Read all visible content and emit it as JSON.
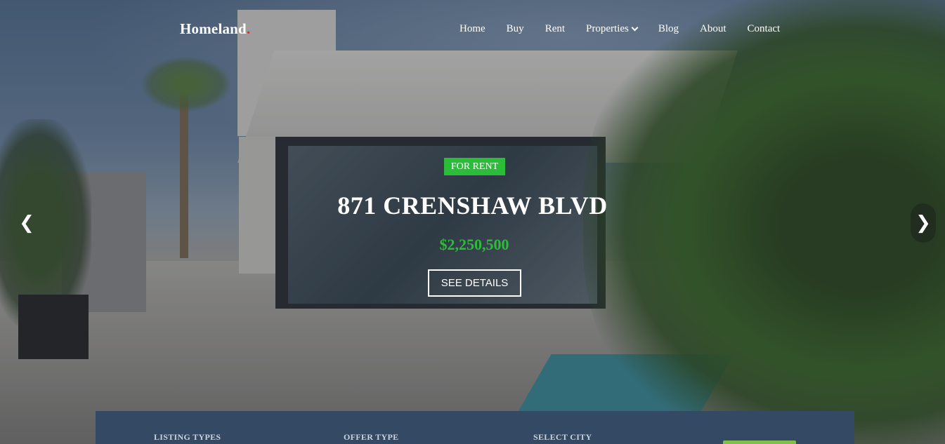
{
  "header": {
    "logo_text": "Homeland",
    "logo_dot": ".",
    "nav": [
      {
        "label": "Home"
      },
      {
        "label": "Buy"
      },
      {
        "label": "Rent"
      },
      {
        "label": "Properties",
        "has_dropdown": true
      },
      {
        "label": "Blog"
      },
      {
        "label": "About"
      },
      {
        "label": "Contact"
      }
    ]
  },
  "hero": {
    "badge": "FOR RENT",
    "title": "871 CRENSHAW BLVD",
    "price": "$2,250,500",
    "button": "SEE DETAILS",
    "prev_arrow": "❮",
    "next_arrow": "❯"
  },
  "search": {
    "listing_types_label": "LISTING TYPES",
    "offer_type_label": "OFFER TYPE",
    "select_city_label": "SELECT CITY"
  },
  "colors": {
    "accent_green": "#2bbd3a",
    "panel_blue": "#344963",
    "logo_dot_red": "#e02f2f"
  }
}
